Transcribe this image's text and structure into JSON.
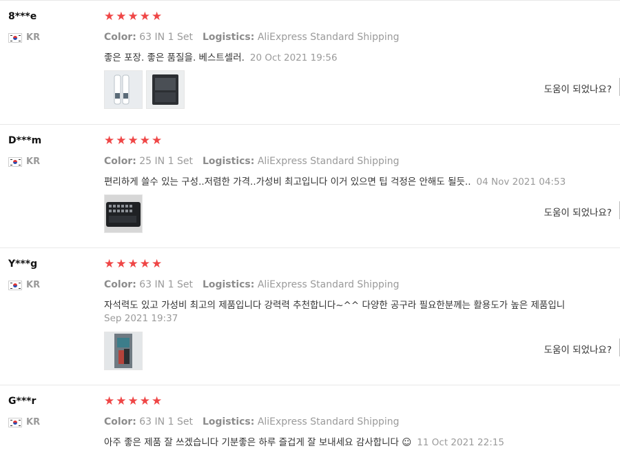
{
  "labels": {
    "color": "Color:",
    "logistics": "Logistics:",
    "helpful": "도움이 되었나요?"
  },
  "reviews": [
    {
      "user": "8***e",
      "country": "KR",
      "stars": 5,
      "color": "63 IN 1 Set",
      "logistics": "AliExpress Standard Shipping",
      "text": "좋은 포장. 좋은 품질을. 베스트셀러.",
      "date": "20 Oct 2021 19:56",
      "photos": [
        "product-photo-tubes",
        "product-photo-case"
      ]
    },
    {
      "user": "D***m",
      "country": "KR",
      "stars": 5,
      "color": "25 IN 1 Set",
      "logistics": "AliExpress Standard Shipping",
      "text": "편리하게 쓸수 있는 구성..저렴한 가격..가성비 최고입니다 이거 있으면 팁 걱정은 안해도 될듯..",
      "date": "04 Nov 2021 04:53",
      "photos": [
        "product-photo-bitset"
      ]
    },
    {
      "user": "Y***g",
      "country": "KR",
      "stars": 5,
      "color": "63 IN 1 Set",
      "logistics": "AliExpress Standard Shipping",
      "text": "자석력도 있고 가성비 최고의 제품입니다 강력력 추천합니다~^^ 다양한 공구라 필요한분께는 활용도가 높은 제품입니",
      "date": "Sep 2021 19:37",
      "photos": [
        "product-photo-inuse"
      ]
    },
    {
      "user": "G***r",
      "country": "KR",
      "stars": 5,
      "color": "63 IN 1 Set",
      "logistics": "AliExpress Standard Shipping",
      "text": "아주 좋은 제품 잘 쓰겠습니다 기분좋은 하루 즐겁게 잘 보내세요 감사합니다 ☺",
      "date": "11 Oct 2021 22:15",
      "photos": []
    }
  ]
}
